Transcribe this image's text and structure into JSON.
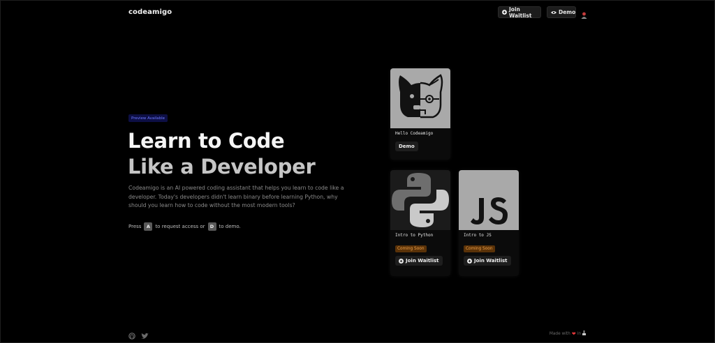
{
  "header": {
    "logo": "codeamigo",
    "join_waitlist": "Join Waitlist",
    "demo": "Demo"
  },
  "hero": {
    "badge": "Preview Available",
    "title_line1": "Learn to Code",
    "title_line2": "Like a Developer",
    "description": "Codeamigo is an AI powered coding assistant that helps you learn to code like a developer. Today's developers didn't learn binary before learning Python, why should you learn how to code without the most modern tools?",
    "press_prefix": "Press",
    "key_a": "A",
    "press_middle": "to request access or",
    "key_d": "D",
    "press_suffix": "to demo."
  },
  "cards": [
    {
      "title": "Hello Codeamigo",
      "button": "Demo",
      "icon": "dog-robot-image"
    },
    {
      "title": "Intro to Python",
      "status": "Coming Soon",
      "button": "Join Waitlist",
      "icon": "python-logo-image"
    },
    {
      "title": "Intro to JS",
      "status": "Coming Soon",
      "button": "Join Waitlist",
      "icon": "js-logo-image"
    }
  ],
  "footer": {
    "made_with": "Made with",
    "in": "in"
  },
  "colors": {
    "accent_badge_bg": "#0d0f45",
    "accent_badge_text": "#6d79ff",
    "coming_soon_bg": "#5a3208",
    "coming_soon_text": "#f1a24a",
    "heart": "#e5383b"
  }
}
